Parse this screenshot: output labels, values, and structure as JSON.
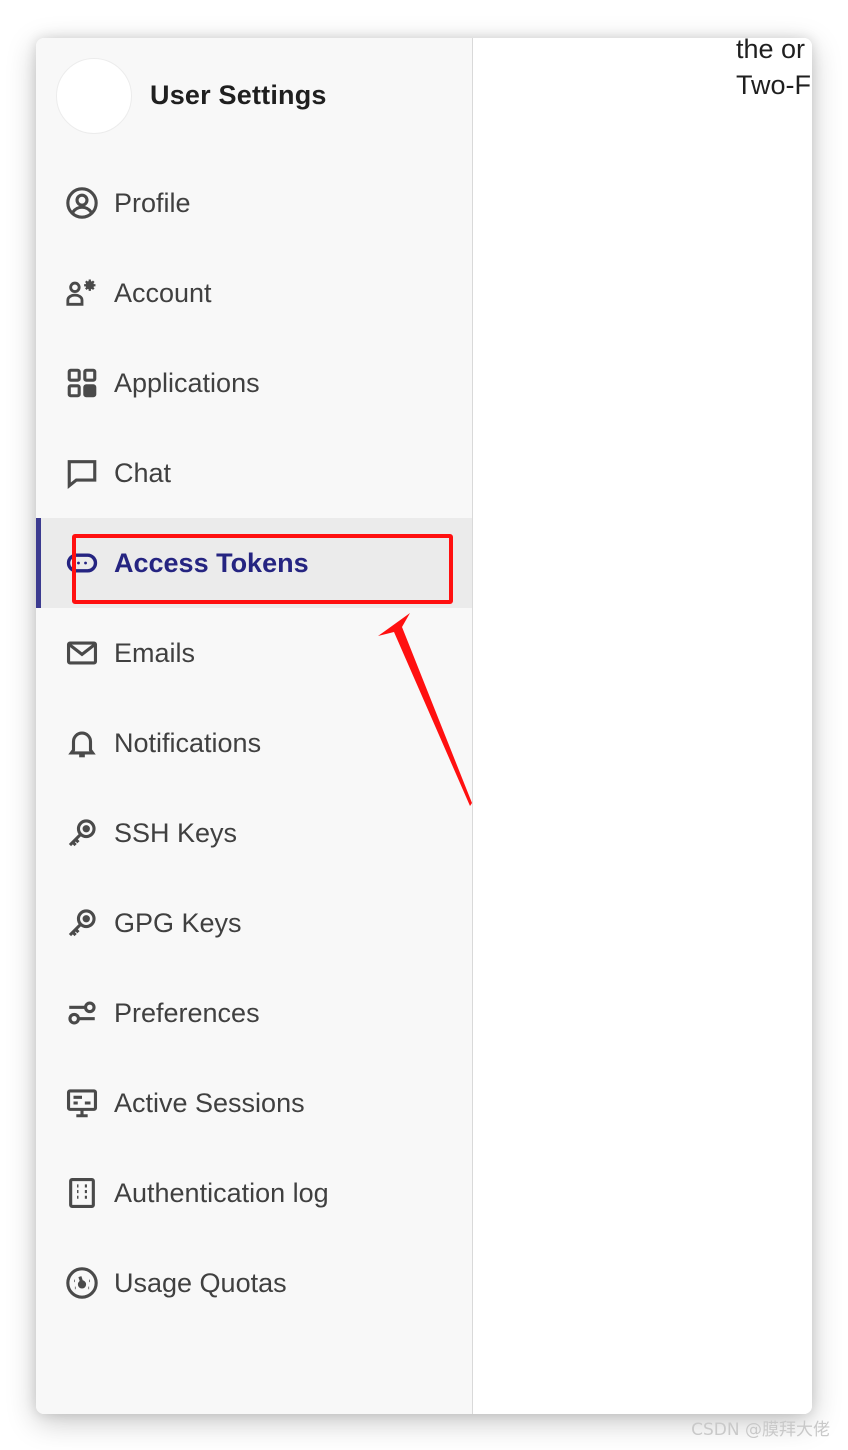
{
  "sidebar": {
    "title": "User Settings",
    "items": [
      {
        "label": "Profile",
        "icon": "profile-icon"
      },
      {
        "label": "Account",
        "icon": "account-icon"
      },
      {
        "label": "Applications",
        "icon": "applications-icon"
      },
      {
        "label": "Chat",
        "icon": "chat-icon"
      },
      {
        "label": "Access Tokens",
        "icon": "access-tokens-icon",
        "active": true
      },
      {
        "label": "Emails",
        "icon": "email-icon"
      },
      {
        "label": "Notifications",
        "icon": "bell-icon"
      },
      {
        "label": "SSH Keys",
        "icon": "key-icon"
      },
      {
        "label": "GPG Keys",
        "icon": "key-icon"
      },
      {
        "label": "Preferences",
        "icon": "preferences-icon"
      },
      {
        "label": "Active Sessions",
        "icon": "monitor-icon"
      },
      {
        "label": "Authentication log",
        "icon": "log-icon"
      },
      {
        "label": "Usage Quotas",
        "icon": "gauge-icon"
      }
    ]
  },
  "main": {
    "line1": "the or",
    "line2": "Two-F"
  },
  "colors": {
    "accent": "#3b3a8f",
    "active_text": "#252481",
    "annotation": "#ff1010",
    "sidebar_bg": "#f8f8f8"
  },
  "watermark": "CSDN @膜拜大佬"
}
